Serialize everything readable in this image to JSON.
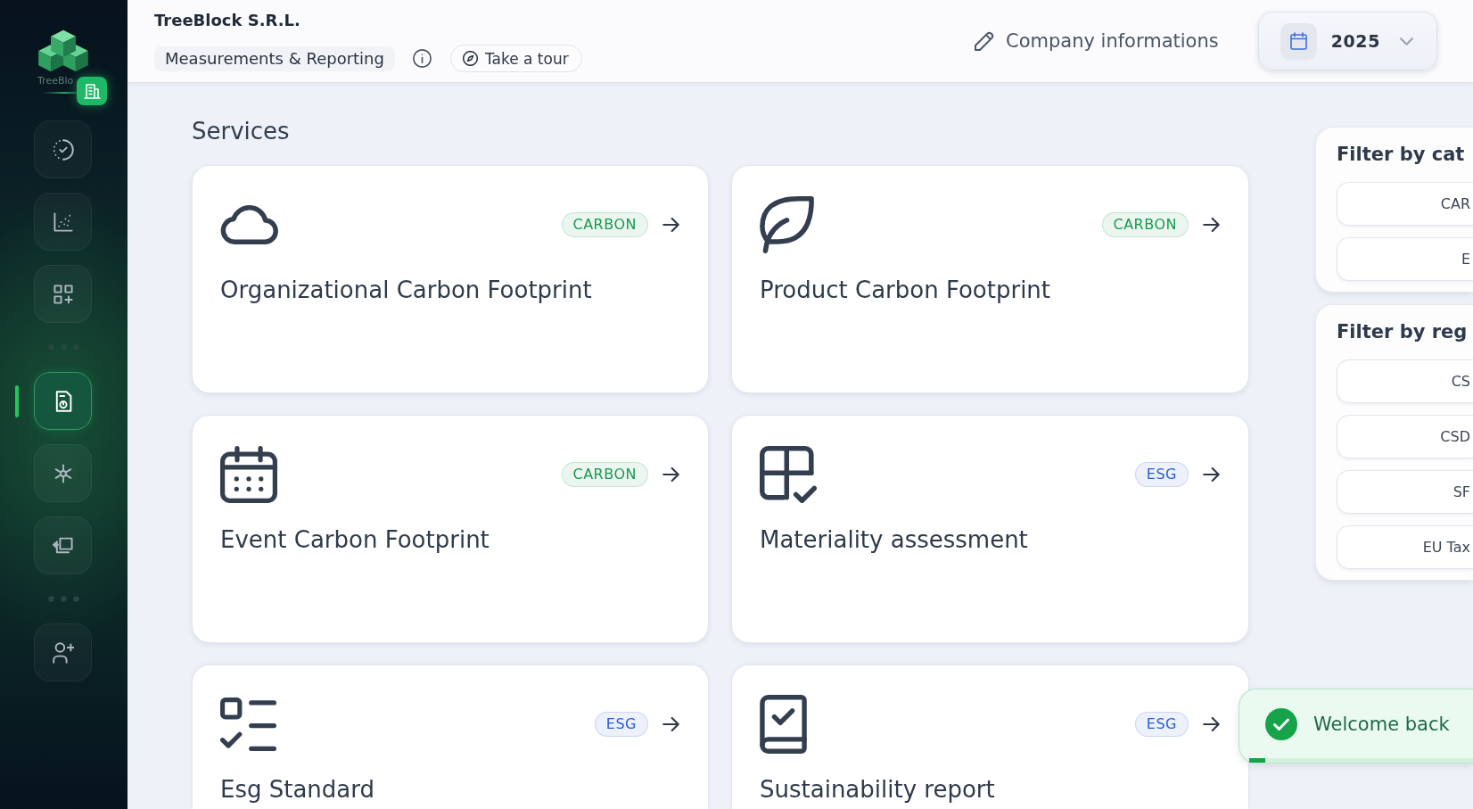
{
  "sidebar": {
    "logo_text": "TreeBlo",
    "groups": [
      {
        "items": [
          {
            "selected": false
          },
          {
            "selected": false
          },
          {
            "selected": false
          }
        ]
      },
      {
        "items": [
          {
            "selected": true
          },
          {
            "selected": false
          },
          {
            "selected": false
          }
        ]
      },
      {
        "items": [
          {
            "selected": false
          }
        ]
      }
    ]
  },
  "header": {
    "company": "TreeBlock S.R.L.",
    "section": "Measurements & Reporting",
    "tour_button": "Take a tour",
    "company_link": "Company informations",
    "year_picker": {
      "value": "2025"
    }
  },
  "content": {
    "title": "Services",
    "services": [
      {
        "title": "Organizational Carbon Footprint",
        "tag": {
          "label": "CARBON",
          "color": "#1a9a4f"
        }
      },
      {
        "title": "Product Carbon Footprint",
        "tag": {
          "label": "CARBON",
          "color": "#1a9a4f"
        }
      },
      {
        "title": "Event Carbon Footprint",
        "tag": {
          "label": "CARBON",
          "color": "#1a9a4f"
        }
      },
      {
        "title": "Materiality assessment",
        "tag": {
          "label": "ESG",
          "color": "#2b5cd6"
        }
      },
      {
        "title": "Esg Standard",
        "tag": {
          "label": "ESG",
          "color": "#2b5cd6"
        }
      },
      {
        "title": "Sustainability report",
        "tag": {
          "label": "ESG",
          "color": "#2b5cd6"
        }
      }
    ]
  },
  "filters": [
    {
      "title": "Filter by cat",
      "options": [
        {
          "label": "CAR"
        },
        {
          "label": "E"
        }
      ]
    },
    {
      "title": "Filter by reg",
      "options": [
        {
          "label": "CS"
        },
        {
          "label": "CSD"
        },
        {
          "label": "SF"
        },
        {
          "label": "EU Tax"
        }
      ]
    }
  ],
  "toast": {
    "message": "Welcome back",
    "level": 0.07
  }
}
